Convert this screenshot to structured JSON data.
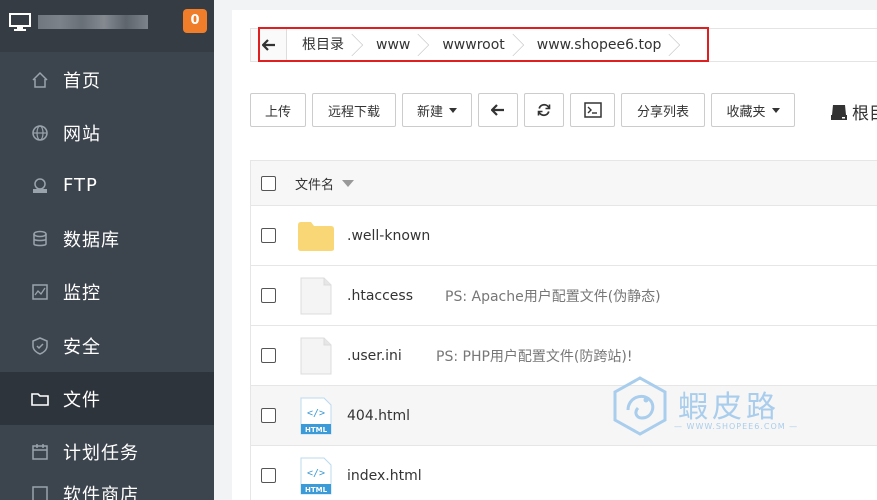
{
  "sidebar": {
    "notification_count": "0",
    "items": [
      {
        "label": "首页",
        "icon": "home-icon"
      },
      {
        "label": "网站",
        "icon": "globe-icon"
      },
      {
        "label": "FTP",
        "icon": "ftp-icon"
      },
      {
        "label": "数据库",
        "icon": "database-icon"
      },
      {
        "label": "监控",
        "icon": "monitor-chart-icon"
      },
      {
        "label": "安全",
        "icon": "shield-icon"
      },
      {
        "label": "文件",
        "icon": "folder-icon",
        "active": true
      },
      {
        "label": "计划任务",
        "icon": "calendar-icon"
      },
      {
        "label": "软件商店",
        "icon": "store-icon"
      }
    ]
  },
  "breadcrumb": [
    "根目录",
    "www",
    "wwwroot",
    "www.shopee6.top"
  ],
  "toolbar": {
    "upload": "上传",
    "remote_download": "远程下载",
    "new": "新建",
    "share_list": "分享列表",
    "favorites": "收藏夹",
    "root": "根目"
  },
  "table": {
    "header_name": "文件名",
    "rows": [
      {
        "name": ".well-known",
        "type": "folder",
        "note": ""
      },
      {
        "name": ".htaccess",
        "type": "file",
        "note": "PS: Apache用户配置文件(伪静态)"
      },
      {
        "name": ".user.ini",
        "type": "file",
        "note": "PS: PHP用户配置文件(防跨站)!"
      },
      {
        "name": "404.html",
        "type": "html",
        "note": ""
      },
      {
        "name": "index.html",
        "type": "html",
        "note": ""
      }
    ]
  },
  "watermark": {
    "title": "蝦皮路",
    "url": "— WWW.SHOPEE6.COM —"
  },
  "colors": {
    "sidebar": "#3c444d",
    "badge": "#f07d29",
    "highlight": "#e02020",
    "folder": "#f9d776"
  }
}
